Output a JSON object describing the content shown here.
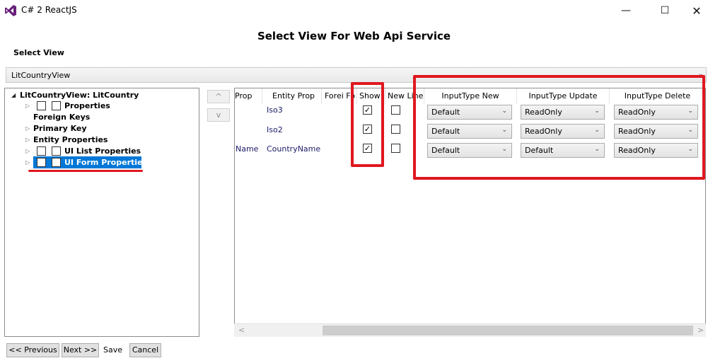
{
  "window": {
    "title": "C# 2 ReactJS"
  },
  "page": {
    "title": "Select View For Web Api Service",
    "select_view_label": "Select View",
    "selected_view": "LitCountryView"
  },
  "tree": {
    "root": "LitCountryView: LitCountry",
    "items": {
      "properties": "Properties",
      "foreign_keys": "Foreign Keys",
      "primary_key": "Primary Key",
      "entity_properties": "Entity Properties",
      "ui_list_properties": "UI List Properties",
      "ui_form_properties": "UI Form Properties"
    }
  },
  "move": {
    "up": "^",
    "down": "v"
  },
  "grid": {
    "headers": {
      "prop": "Prop",
      "entity_prop": "Entity Prop",
      "foreign": "Forei Fo",
      "show": "Show",
      "new_line": "New Line",
      "input_new": "InputType New",
      "input_update": "InputType Update",
      "input_delete": "InputType Delete"
    },
    "rows": [
      {
        "prop": "",
        "entity_prop": "Iso3",
        "show": true,
        "new_line": false,
        "input_new": "Default",
        "input_update": "ReadOnly",
        "input_delete": "ReadOnly"
      },
      {
        "prop": "",
        "entity_prop": "Iso2",
        "show": true,
        "new_line": false,
        "input_new": "Default",
        "input_update": "ReadOnly",
        "input_delete": "ReadOnly"
      },
      {
        "prop": "Name",
        "entity_prop": "CountryName",
        "show": true,
        "new_line": false,
        "input_new": "Default",
        "input_update": "Default",
        "input_delete": "ReadOnly"
      }
    ]
  },
  "footer": {
    "previous": "<< Previous",
    "next": "Next >>",
    "save": "Save",
    "cancel": "Cancel"
  },
  "colors": {
    "highlight": "#0078d7",
    "annotation_red": "#e0171f",
    "vs_purple": "#68217a"
  },
  "icons": {
    "app": "visual-studio-icon",
    "minimize": "minimize-icon",
    "maximize": "maximize-icon",
    "close": "close-icon"
  }
}
